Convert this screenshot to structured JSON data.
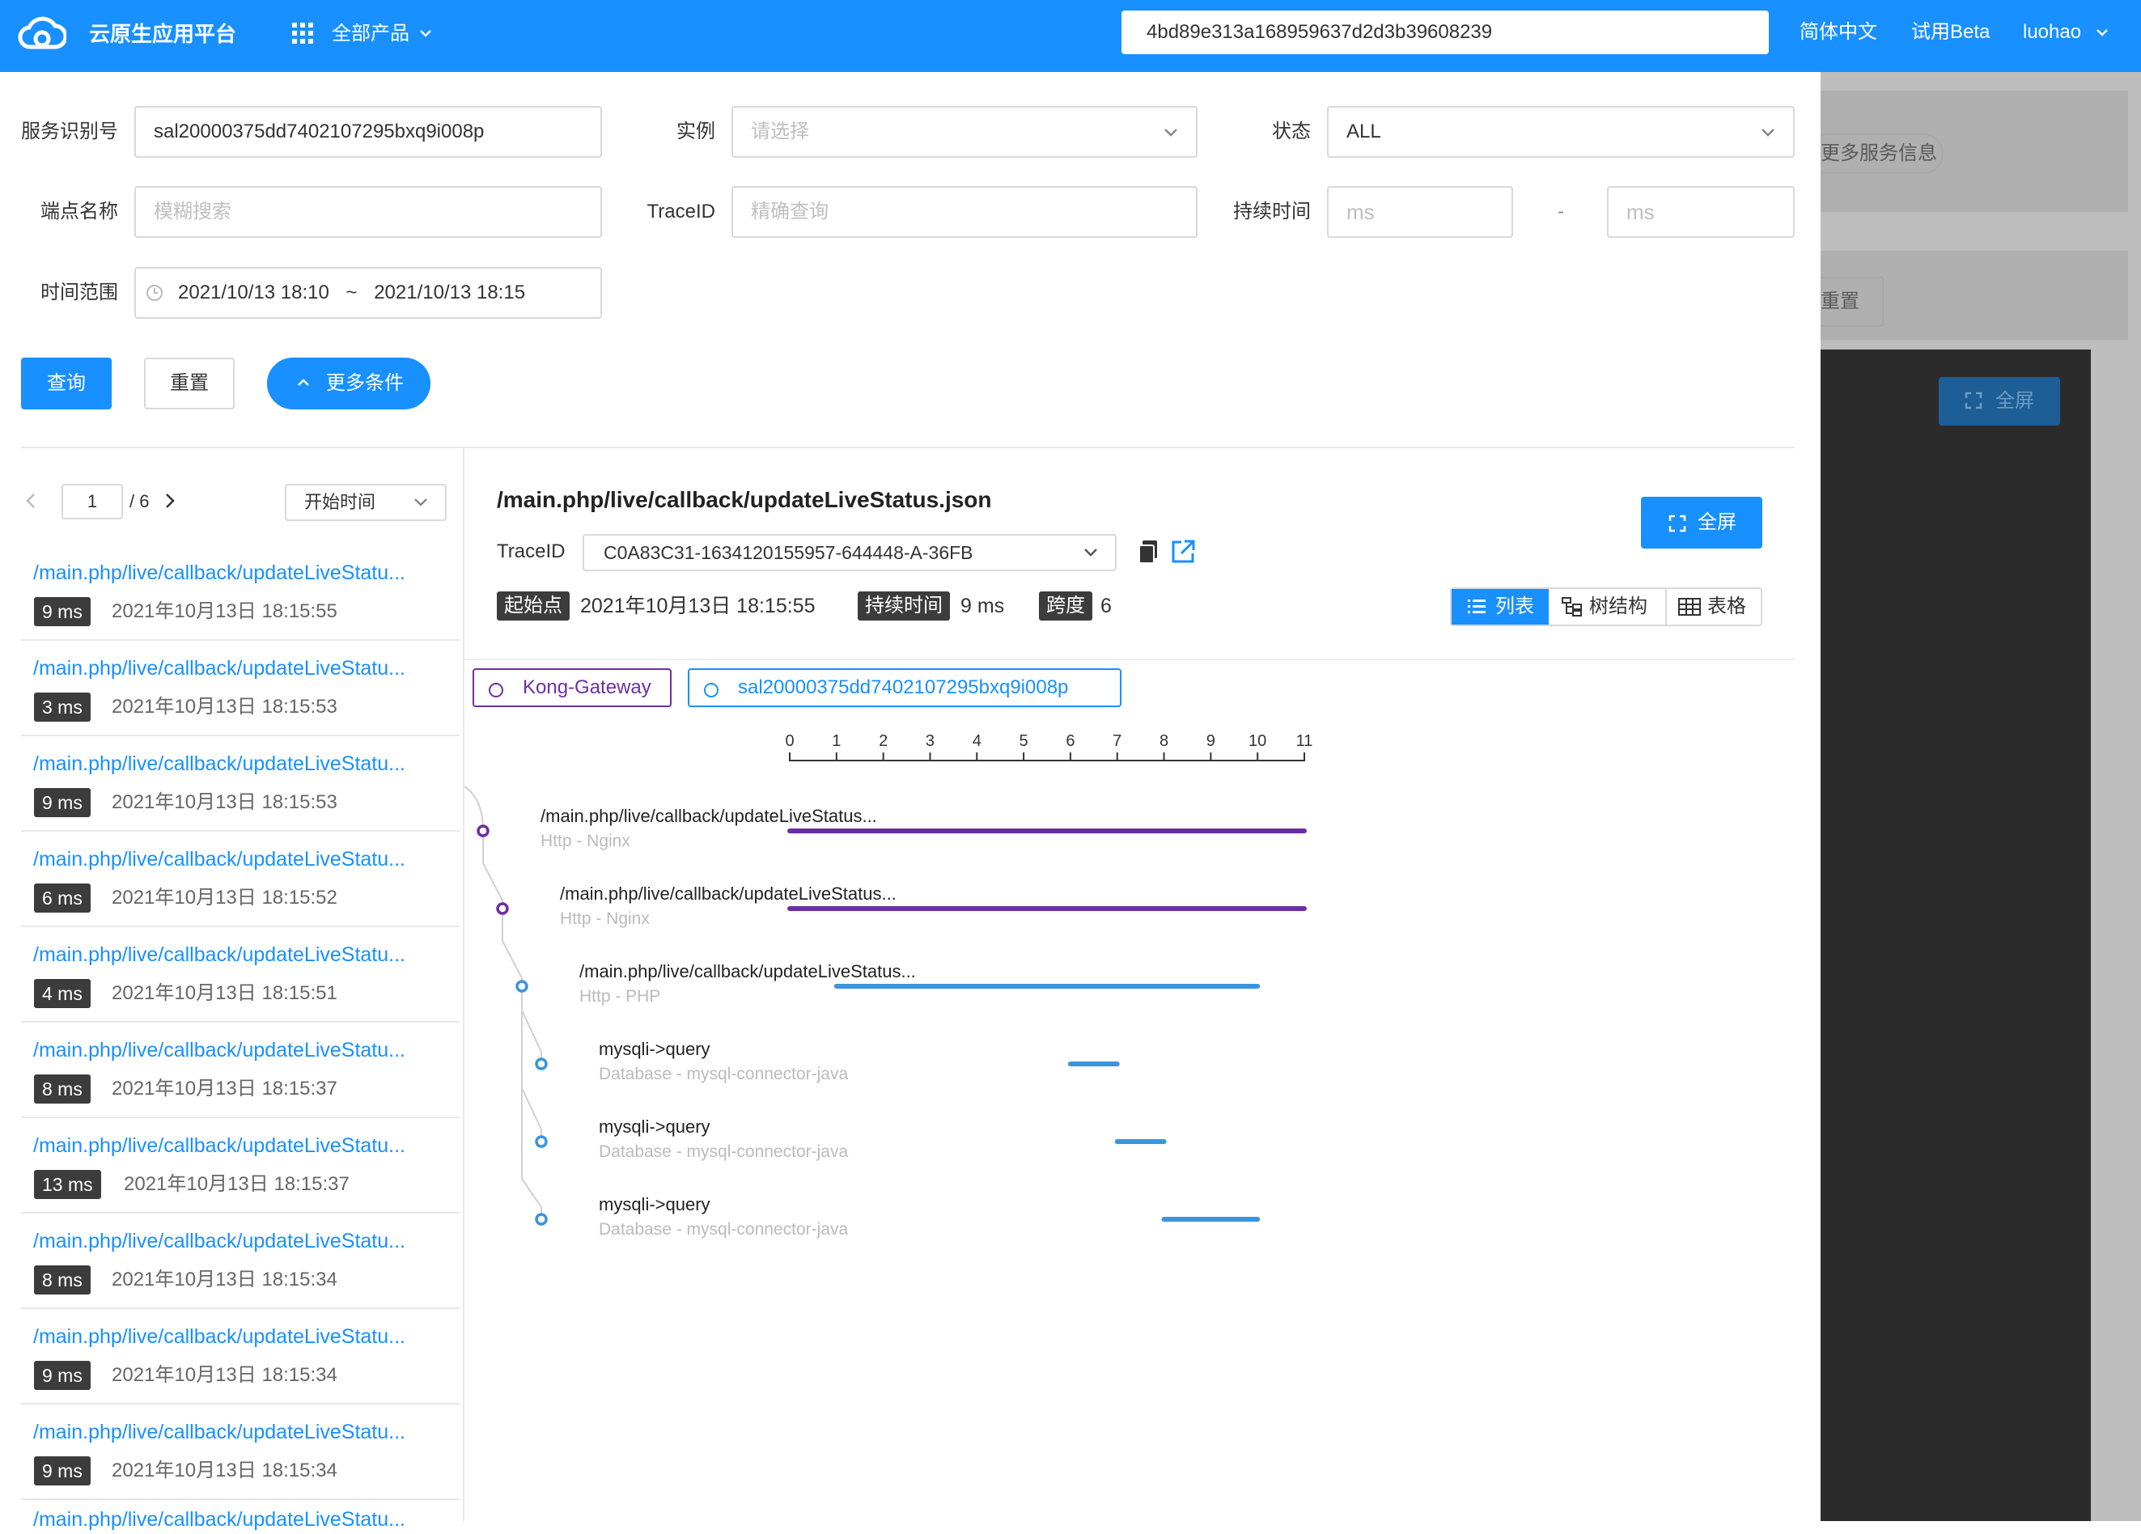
{
  "topbar": {
    "app_title": "云原生应用平台",
    "products_label": "全部产品",
    "search_value": "4bd89e313a168959637d2d3b39608239",
    "language": "简体中文",
    "beta": "试用Beta",
    "user": "luohao"
  },
  "backdrop": {
    "more_info": "更多服务信息",
    "reset": "重置",
    "fullscreen": "全屏"
  },
  "filters": {
    "service_id_label": "服务识别号",
    "service_id_value": "sal20000375dd7402107295bxq9i008p",
    "instance_label": "实例",
    "instance_placeholder": "请选择",
    "status_label": "状态",
    "status_value": "ALL",
    "endpoint_label": "端点名称",
    "endpoint_placeholder": "模糊搜索",
    "traceid_label": "TraceID",
    "traceid_placeholder": "精确查询",
    "duration_label": "持续时间",
    "duration_min_placeholder": "ms",
    "duration_sep": "-",
    "duration_max_placeholder": "ms",
    "timerange_label": "时间范围",
    "time_start": "2021/10/13 18:10",
    "time_sep": "~",
    "time_end": "2021/10/13 18:15",
    "query_button": "查询",
    "reset_button": "重置",
    "more_button": "更多条件"
  },
  "pagination": {
    "current": "1",
    "total": "/ 6",
    "sort_label": "开始时间"
  },
  "traces": [
    {
      "path": "/main.php/live/callback/updateLiveStatu...",
      "duration": "9 ms",
      "time": "2021年10月13日 18:15:55"
    },
    {
      "path": "/main.php/live/callback/updateLiveStatu...",
      "duration": "3 ms",
      "time": "2021年10月13日 18:15:53"
    },
    {
      "path": "/main.php/live/callback/updateLiveStatu...",
      "duration": "9 ms",
      "time": "2021年10月13日 18:15:53"
    },
    {
      "path": "/main.php/live/callback/updateLiveStatu...",
      "duration": "6 ms",
      "time": "2021年10月13日 18:15:52"
    },
    {
      "path": "/main.php/live/callback/updateLiveStatu...",
      "duration": "4 ms",
      "time": "2021年10月13日 18:15:51"
    },
    {
      "path": "/main.php/live/callback/updateLiveStatu...",
      "duration": "8 ms",
      "time": "2021年10月13日 18:15:37"
    },
    {
      "path": "/main.php/live/callback/updateLiveStatu...",
      "duration": "13 ms",
      "time": "2021年10月13日 18:15:37"
    },
    {
      "path": "/main.php/live/callback/updateLiveStatu...",
      "duration": "8 ms",
      "time": "2021年10月13日 18:15:34"
    },
    {
      "path": "/main.php/live/callback/updateLiveStatu...",
      "duration": "9 ms",
      "time": "2021年10月13日 18:15:34"
    },
    {
      "path": "/main.php/live/callback/updateLiveStatu...",
      "duration": "9 ms",
      "time": "2021年10月13日 18:15:34"
    }
  ],
  "trace_partial": "/main.php/live/callback/updateLiveStatu...",
  "detail": {
    "title": "/main.php/live/callback/updateLiveStatus.json",
    "fullscreen": "全屏",
    "traceid_label": "TraceID",
    "traceid_value": "C0A83C31-1634120155957-644448-A-36FB",
    "start_tag": "起始点",
    "start_value": "2021年10月13日 18:15:55",
    "duration_tag": "持续时间",
    "duration_value": "9 ms",
    "span_tag": "跨度",
    "span_value": "6",
    "view_list": "列表",
    "view_tree": "树结构",
    "view_table": "表格"
  },
  "services": [
    {
      "name": "Kong-Gateway",
      "color": "#6c2fa3"
    },
    {
      "name": "sal20000375dd7402107295bxq9i008p",
      "color": "#1890ff"
    }
  ],
  "timeline": {
    "ticks": [
      "0",
      "1",
      "2",
      "3",
      "4",
      "5",
      "6",
      "7",
      "8",
      "9",
      "10",
      "11"
    ],
    "max": 11,
    "spans": [
      {
        "name": "/main.php/live/callback/updateLiveStatus...",
        "sub": "Http - Nginx",
        "depth": 0,
        "start": 0,
        "end": 11,
        "color": "#6c2fa3"
      },
      {
        "name": "/main.php/live/callback/updateLiveStatus...",
        "sub": "Http - Nginx",
        "depth": 1,
        "start": 0,
        "end": 11,
        "color": "#6c2fa3"
      },
      {
        "name": "/main.php/live/callback/updateLiveStatus...",
        "sub": "Http - PHP",
        "depth": 2,
        "start": 1,
        "end": 10,
        "color": "#3a94e0"
      },
      {
        "name": "mysqli->query",
        "sub": "Database - mysql-connector-java",
        "depth": 3,
        "start": 6,
        "end": 7,
        "color": "#3a94e0"
      },
      {
        "name": "mysqli->query",
        "sub": "Database - mysql-connector-java",
        "depth": 3,
        "start": 7,
        "end": 8,
        "color": "#3a94e0"
      },
      {
        "name": "mysqli->query",
        "sub": "Database - mysql-connector-java",
        "depth": 3,
        "start": 8,
        "end": 10,
        "color": "#3a94e0"
      }
    ]
  },
  "colors": {
    "primary": "#1890ff",
    "gateway": "#6c2fa3",
    "badge": "#3c3c3c"
  }
}
